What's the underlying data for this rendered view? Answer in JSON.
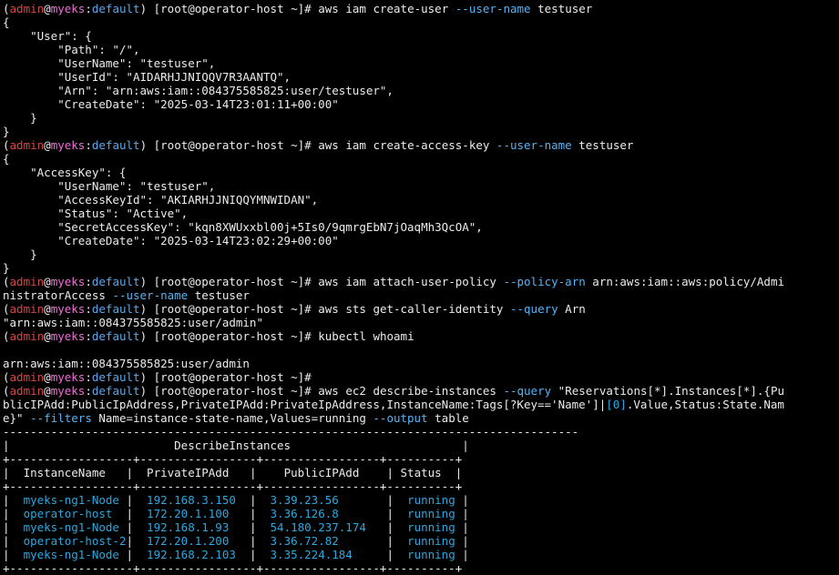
{
  "colors": {
    "background": "#000000",
    "text": "#ececec",
    "prompt_user": "#d54747",
    "prompt_host": "#ec6fd6",
    "prompt_namespace": "#5aa8ee",
    "option": "#56b3f5",
    "result": "#2aa8e0"
  },
  "prompt": {
    "open": "(",
    "user": "admin",
    "at": "@",
    "host": "myeks",
    "sep": ":",
    "ns": "default",
    "close": ")",
    "shell": " [root@operator-host ~]# "
  },
  "commands": [
    {
      "name": "create-user",
      "pre": "aws iam create-user ",
      "o1": "--user-name",
      "post": " testuser"
    },
    {
      "name": "create-access-key",
      "pre": "aws iam create-access-key ",
      "o1": "--user-name",
      "post": " testuser"
    },
    {
      "name": "attach-policy",
      "pre": "aws iam attach-user-policy ",
      "o1": "--policy-arn",
      "mid": " arn:aws:iam::aws:policy/Admi",
      "cont": "nistratorAccess ",
      "o2": "--user-name",
      "post": " testuser"
    },
    {
      "name": "get-caller-identity",
      "pre": "aws sts get-caller-identity ",
      "o1": "--query",
      "post": " Arn"
    },
    {
      "name": "whoami",
      "pre": "kubectl whoami"
    },
    {
      "name": "describe-instances",
      "pre": "aws ec2 describe-instances ",
      "o1": "--query",
      "q1": " \"Reservations[*].Instances[*].{Pu",
      "q2": "blicIPAdd:PublicIpAddress,PrivateIPAdd:PrivateIpAddress,InstanceName:Tags[?Key=='Name']|",
      "q3": "[0]",
      "q4": ".Value,Status:State.Nam",
      "q5": "e}\" ",
      "o2": "--filters",
      "q6": " Name=instance-state-name,Values=running ",
      "o3": "--output",
      "post": " table"
    }
  ],
  "outputs": {
    "create_user": [
      "{",
      "    \"User\": {",
      "        \"Path\": \"/\",",
      "        \"UserName\": \"testuser\",",
      "        \"UserId\": \"AIDARHJJNIQQV7R3AANTQ\",",
      "        \"Arn\": \"arn:aws:iam::084375585825:user/testuser\",",
      "        \"CreateDate\": \"2025-03-14T23:01:11+00:00\"",
      "    }",
      "}"
    ],
    "create_access_key": [
      "{",
      "    \"AccessKey\": {",
      "        \"UserName\": \"testuser\",",
      "        \"AccessKeyId\": \"AKIARHJJNIQQYMNWIDAN\",",
      "        \"Status\": \"Active\",",
      "        \"SecretAccessKey\": \"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\",",
      "        \"CreateDate\": \"2025-03-14T23:02:29+00:00\"",
      "    }",
      "}"
    ],
    "caller_identity": "\"arn:aws:iam::084375585825:user/admin\"",
    "whoami_blank": "",
    "whoami": "arn:aws:iam::084375585825:user/admin"
  },
  "table": {
    "rule": "------------------------------------------------------------------------------------",
    "title": "|                        DescribeInstances                         |",
    "sep": "+------------------+-----------------+-----------------+----------+",
    "headers": [
      "  InstanceName   ",
      "  PrivateIPAdd   ",
      "    PublicIPAdd    ",
      " Status  "
    ],
    "rows": [
      {
        "name": "  myeks-ng1-Node ",
        "priv": "  192.168.3.150  ",
        "pub": "  3.39.23.56       ",
        "status": "  running "
      },
      {
        "name": "  operator-host  ",
        "priv": "  172.20.1.100   ",
        "pub": "  3.36.126.8       ",
        "status": "  running "
      },
      {
        "name": "  myeks-ng1-Node ",
        "priv": "  192.168.1.93   ",
        "pub": "  54.180.237.174   ",
        "status": "  running "
      },
      {
        "name": "  operator-host-2",
        "priv": "  172.20.1.200   ",
        "pub": "  3.36.72.82       ",
        "status": "  running "
      },
      {
        "name": "  myeks-ng1-Node ",
        "priv": "  192.168.2.103  ",
        "pub": "  3.35.224.184     ",
        "status": "  running "
      }
    ]
  }
}
